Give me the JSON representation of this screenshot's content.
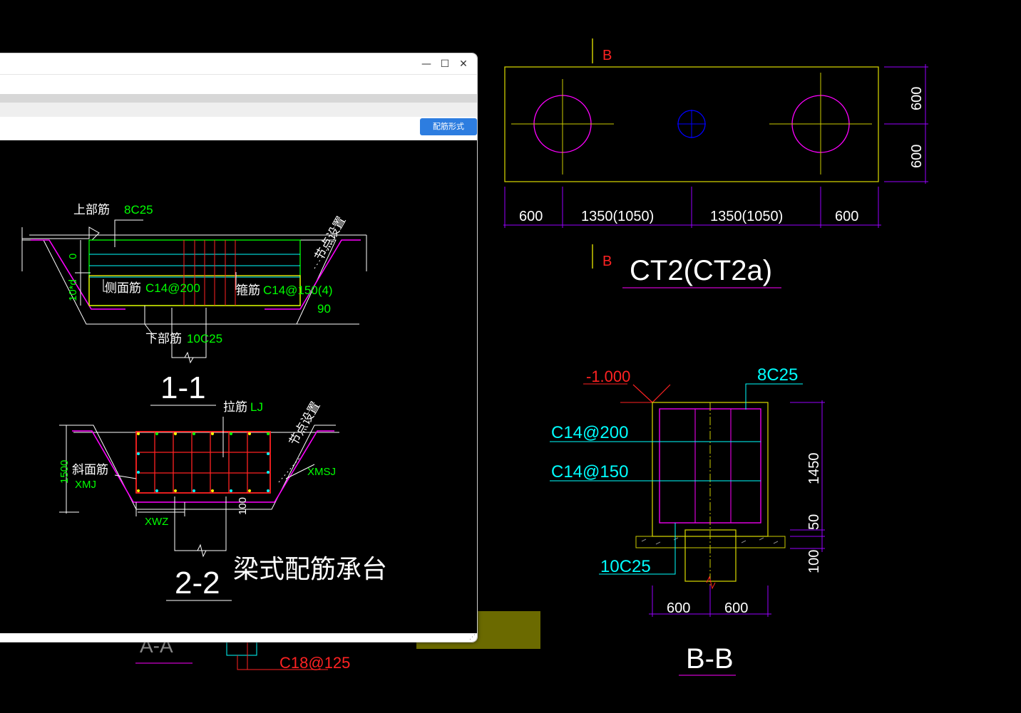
{
  "window": {
    "minimize_label": "—",
    "maximize_label": "☐",
    "close_label": "✕",
    "reinforcement_button": "配筋形式"
  },
  "section_1_1": {
    "top_bar_label": "上部筋",
    "top_bar_value": "8C25",
    "side_bar_label": "侧面筋",
    "side_bar_value": "C14@200",
    "stirrup_label": "箍筋",
    "stirrup_value": "C14@150(4)",
    "bottom_bar_label": "下部筋",
    "bottom_bar_value": "10C25",
    "node_setting": "节点设置",
    "angle": "90",
    "dim_zero": "0",
    "dim_10d": "10*d",
    "title": "1-1"
  },
  "section_2_2": {
    "tie_label": "拉筋",
    "tie_value": "LJ",
    "node_setting": "节点设置",
    "slope_bar_label": "斜面筋",
    "slope_bar_value": "XMJ",
    "xmsj": "XMSJ",
    "xwz": "XWZ",
    "dim_1500": "1500",
    "dim_100": "100",
    "title": "2-2",
    "caption": "梁式配筋承台"
  },
  "plan": {
    "section_mark": "B",
    "dims_bottom": [
      "600",
      "1350(1050)",
      "1350(1050)",
      "600"
    ],
    "dims_right": [
      "600",
      "600"
    ],
    "title": "CT2(CT2a)"
  },
  "section_b_b": {
    "elevation": "-1.000",
    "top_bar": "8C25",
    "side_bar_1": "C14@200",
    "side_bar_2": "C14@150",
    "bottom_bar": "10C25",
    "dims_right": [
      "1450",
      "50",
      "100"
    ],
    "dims_bottom": [
      "600",
      "600"
    ],
    "title": "B-B"
  },
  "background_fragments": {
    "aa_title": "A-A",
    "c18": "C18@125"
  },
  "colors": {
    "background": "#000000",
    "cad_yellow": "#ffff00",
    "cad_magenta": "#ff00ff",
    "cad_cyan": "#00ffff",
    "cad_green": "#00ff00",
    "cad_red": "#ff0000",
    "cad_blue": "#0000ff",
    "cad_purple": "#9900ff",
    "cad_white": "#ffffff",
    "button_blue": "#2d7de0"
  }
}
